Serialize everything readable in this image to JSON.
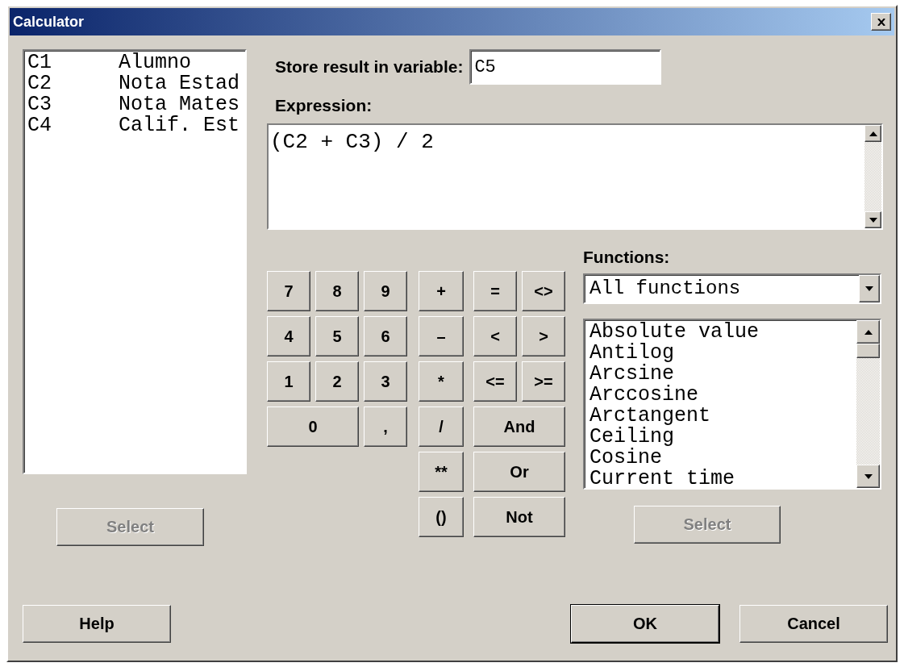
{
  "window": {
    "title": "Calculator"
  },
  "columns": [
    {
      "id": "C1",
      "name": "Alumno"
    },
    {
      "id": "C2",
      "name": "Nota Estad"
    },
    {
      "id": "C3",
      "name": "Nota Mates"
    },
    {
      "id": "C4",
      "name": "Calif. Est"
    }
  ],
  "left_select": {
    "label": "Select",
    "disabled": true
  },
  "store": {
    "label": "Store result in variable:",
    "value": "C5"
  },
  "expression": {
    "label": "Expression:",
    "value": "(C2 + C3) / 2"
  },
  "keypad": {
    "digits": [
      [
        "7",
        "8",
        "9"
      ],
      [
        "4",
        "5",
        "6"
      ],
      [
        "1",
        "2",
        "3"
      ],
      [
        "0",
        ","
      ]
    ],
    "operators": [
      "+",
      "–",
      "*",
      "/",
      "**",
      "()"
    ],
    "logic": [
      [
        "=",
        "<>"
      ],
      [
        "<",
        ">"
      ],
      [
        "<=",
        ">="
      ],
      [
        "And"
      ],
      [
        "Or"
      ],
      [
        "Not"
      ]
    ]
  },
  "functions": {
    "label": "Functions:",
    "category": "All functions",
    "items": [
      "Absolute value",
      "Antilog",
      "Arcsine",
      "Arccosine",
      "Arctangent",
      "Ceiling",
      "Cosine",
      "Current time"
    ],
    "select": {
      "label": "Select",
      "disabled": true
    }
  },
  "buttons": [
    {
      "label": "Help",
      "default": false
    },
    {
      "label": "OK",
      "default": true
    },
    {
      "label": "Cancel",
      "default": false
    }
  ]
}
